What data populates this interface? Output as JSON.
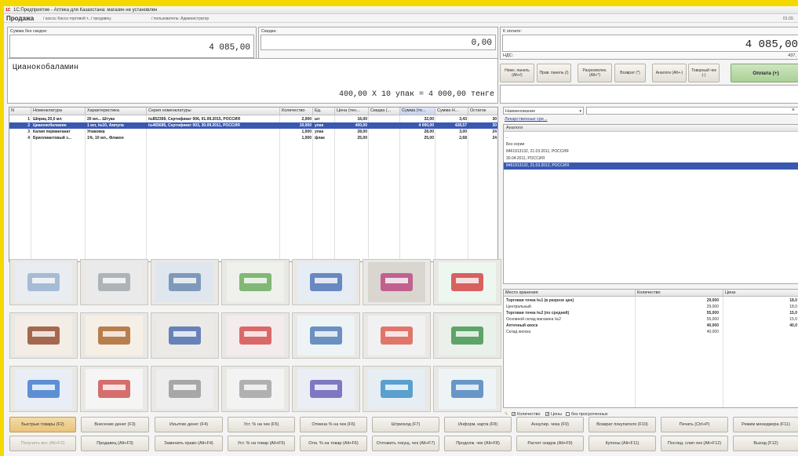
{
  "window": {
    "title": "1С:Предприятие - Аптека для Казахстана: магазин не установлен",
    "app_title": "Продажа",
    "kassa": "/ касса: Касса торговой т.../ продавец:",
    "user": "/ пользователь: Администратор",
    "date": "01.03."
  },
  "totals": {
    "sum_label": "Сумма без скидок:",
    "sum_value": "4 085,00",
    "discount_label": "Скидка:",
    "discount_value": "0,00",
    "to_pay_label": "К оплате:",
    "to_pay_value": "4 085,00",
    "vat_label": "НДС:",
    "vat_value": "437,"
  },
  "product": {
    "name": "Цианокобаламин",
    "calc": "400,00  X 10 упак = 4 000,00  тенге"
  },
  "actions": {
    "num_panel": "Нижн. панель (Alt+/)",
    "right_panel": "Прав. панель (/)",
    "unpack": "Разукомплек. (Alt+*)",
    "return": "Возврат (*)",
    "analogs": "Аналоги (Alt+-)",
    "receipt": "Товарный чек (-)",
    "pay": "Оплата (+)"
  },
  "table": {
    "headers": [
      "N",
      "Номенклатура",
      "Характеристика",
      "Серия номенклатуры",
      "Количество",
      "Ед.",
      "Цена (тен...",
      "Скидка (...",
      "Сумма (те...",
      "Сумма Н...",
      "Остаток"
    ],
    "rows": [
      [
        "1",
        "Шприц 20,0 мл",
        "20 мл... Штука",
        "№852369, Сертификат 006, 01.09.2015, РОССИЯ",
        "2,000",
        "шт",
        "16,00",
        "",
        "32,00",
        "3,43",
        "30"
      ],
      [
        "2",
        "Цианокобаламин",
        "1 мл, №10, Ампула",
        "№465685, Сертификат 003, 30.09.2011, РОССИЯ",
        "10,000",
        "упак",
        "400,00",
        "",
        "4 000,00",
        "428,57",
        "30"
      ],
      [
        "3",
        "Калия перманганат",
        "Упаковка",
        "",
        "1,000",
        "упак",
        "28,00",
        "",
        "28,00",
        "3,00",
        "24"
      ],
      [
        "4",
        "Бриллиантовый з...",
        "1%, 10 мл., Флакон",
        "",
        "1,000",
        "флак",
        "25,00",
        "",
        "25,00",
        "2,68",
        "24"
      ]
    ]
  },
  "search": {
    "field": "Наименование",
    "link": "Лекарственные сре...",
    "group": "Аналоги",
    "items": [
      "..",
      "Без серии",
      "8461913132, 21.03.2011, РОССИЯ",
      "30.04.2011, РОССИЯ",
      "8461913132, 21.03.2012, РОССИЯ"
    ]
  },
  "stock": {
    "headers": [
      "Место хранения",
      "Количество",
      "Цена"
    ],
    "rows": [
      [
        "Торговая точка №1 (в разрезе цен)",
        "29,000",
        "18,0"
      ],
      [
        "Центральный",
        "29,000",
        "18,0"
      ],
      [
        "Торговая точка №2 (по средней)",
        "55,000",
        "15,0"
      ],
      [
        "Основной склад магазина №2",
        "55,000",
        "15,0"
      ],
      [
        "Аптечный киоск",
        "40,000",
        "40,0"
      ],
      [
        "Склад киоска",
        "40,000",
        ""
      ]
    ],
    "opt_qty": "Количество",
    "opt_price": "Цены",
    "opt_expired": "без просроченных"
  },
  "buttons_row1": [
    "Быстрые товары (F2)",
    "Внесение денег (F3)",
    "Изъятие денег (F4)",
    "Уст. % на чек (F5)",
    "Отмена % на чек (F6)",
    "Штрихкод (F7)",
    "Информ. карта (F8)",
    "Аннулир. чека (F9)",
    "Возврат покупателя (F10)",
    "Печать (Ctrl+P)",
    "Режим менеджера (F11)"
  ],
  "buttons_row2": [
    "Получить вес (Alt+F2)",
    "Продавец (Alt+F3)",
    "Заменить право (Alt+F4)",
    "Уст. % на товар (Alt+F5)",
    "Отм. % на товар (Alt+F6)",
    "Отложить текущ. чек (Alt+F7)",
    "Продолж. чек (Alt+F8)",
    "Расчет скидок (Alt+F9)",
    "Купоны (Alt+F11)",
    "Послед. слип чек (Alt+F12)",
    "Выход (F12)"
  ],
  "colors": {
    "accent": "#3a58b0",
    "highlight": "#e9c37b",
    "pay": "#a9d193"
  }
}
